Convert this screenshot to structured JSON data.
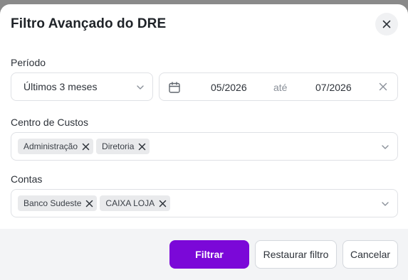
{
  "dialog": {
    "title": "Filtro Avançado do DRE"
  },
  "periodo": {
    "label": "Período",
    "preset": "Últimos 3 meses",
    "start": "05/2026",
    "separator": "até",
    "end": "07/2026"
  },
  "centro_custos": {
    "label": "Centro de Custos",
    "chips": [
      "Administração",
      "Diretoria"
    ]
  },
  "contas": {
    "label": "Contas",
    "chips": [
      "Banco Sudeste",
      "CAIXA LOJA"
    ]
  },
  "footer": {
    "filter_label": "Filtrar",
    "reset_label": "Restaurar filtro",
    "cancel_label": "Cancelar"
  },
  "colors": {
    "primary": "#7b08d8",
    "chip_bg": "#e9eaec",
    "footer_bg": "#f3f4f6"
  },
  "icons": {
    "close": "close-icon",
    "calendar": "calendar-icon",
    "chevron": "chevron-down-icon",
    "chip_remove": "x-icon"
  }
}
